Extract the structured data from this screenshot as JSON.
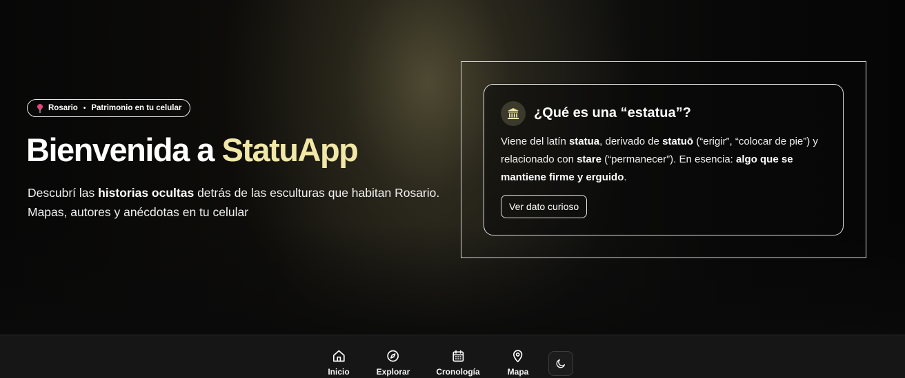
{
  "hero": {
    "badge": {
      "location": "Rosario",
      "separator": "•",
      "tagline": "Patrimonio en tu celular",
      "icon": "pin-icon"
    },
    "title_prefix": "Bienvenida a ",
    "title_accent": "StatuApp",
    "description": {
      "part1": "Descubrí las ",
      "bold1": "historias ocultas",
      "part2": " detrás de las esculturas que habitan Rosario. Mapas, autores y anécdotas en tu celular"
    }
  },
  "card": {
    "icon": "museum-icon",
    "title": "¿Qué es una “estatua”?",
    "body": {
      "t1": "Viene del latín ",
      "b1": "statua",
      "t2": ", derivado de ",
      "b2": "statuō",
      "t3": " (“erigir”, “colocar de pie”) y relacionado con ",
      "b3": "stare",
      "t4": " (“permanecer”). En esencia: ",
      "b4": "algo que se mantiene firme y erguido",
      "t5": "."
    },
    "button_label": "Ver dato curioso"
  },
  "nav": {
    "items": [
      {
        "label": "Inicio",
        "icon": "home-icon"
      },
      {
        "label": "Explorar",
        "icon": "compass-icon"
      },
      {
        "label": "Cronología",
        "icon": "calendar-icon"
      },
      {
        "label": "Mapa",
        "icon": "map-pin-icon"
      }
    ],
    "theme_toggle_icon": "moon-icon"
  },
  "colors": {
    "accent": "#f1e7a6",
    "pin": "#e0457b",
    "background": "#0a0a0a",
    "nav_background": "#161616"
  }
}
